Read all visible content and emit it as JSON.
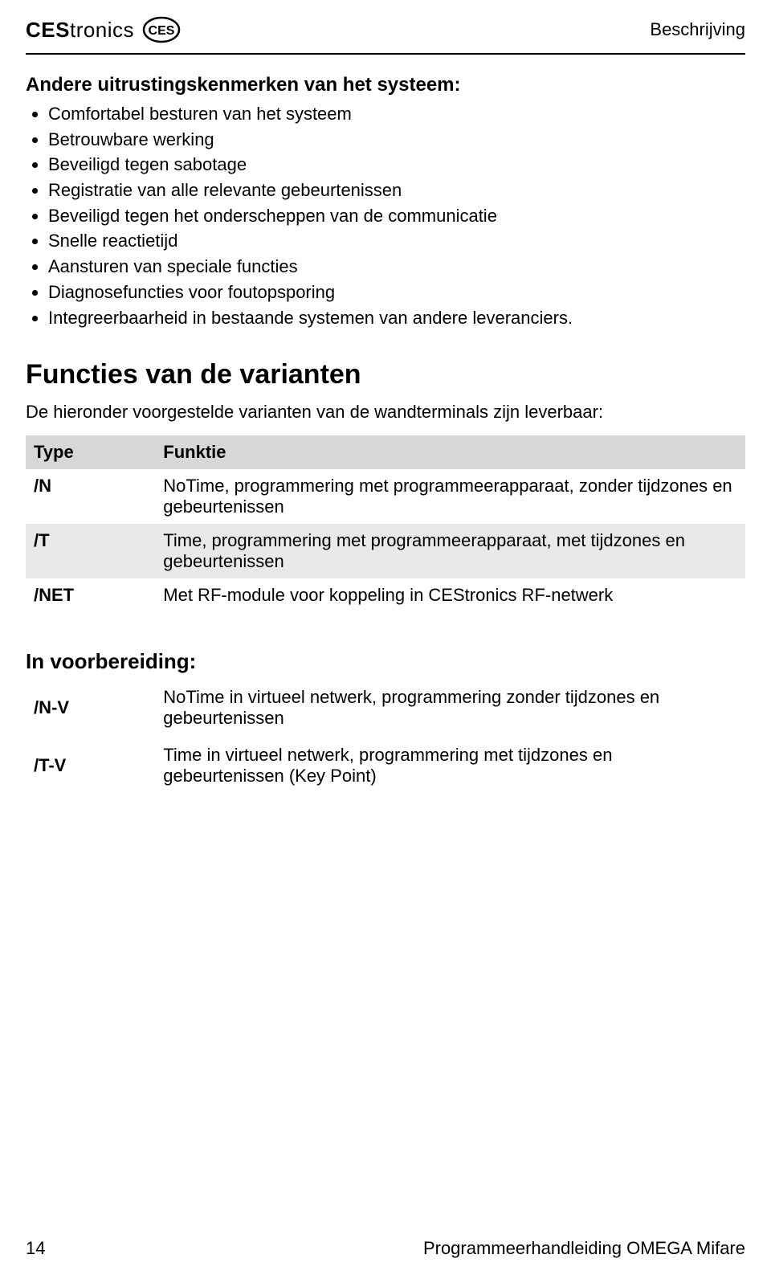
{
  "header": {
    "brand_ces": "CES",
    "brand_tronics": "tronics",
    "right": "Beschrijving"
  },
  "section1": {
    "title": "Andere uitrustingskenmerken van het systeem:",
    "items": [
      "Comfortabel besturen van het systeem",
      "Betrouwbare werking",
      "Beveiligd tegen sabotage",
      "Registratie van alle relevante gebeurtenissen",
      "Beveiligd tegen het onderscheppen van de communicatie",
      "Snelle reactietijd",
      "Aansturen van speciale functies",
      "Diagnosefuncties voor foutopsporing",
      "Integreerbaarheid in bestaande systemen van andere leveranciers."
    ]
  },
  "section2": {
    "heading": "Functies van de varianten",
    "intro": "De hieronder voorgestelde varianten van de wandterminals zijn leverbaar:",
    "table": {
      "header_type": "Type",
      "header_function": "Funktie",
      "rows": [
        {
          "type": "/N",
          "func": "NoTime, programmering met programmeer­apparaat, zonder tijdzones en gebeurtenissen"
        },
        {
          "type": "/T",
          "func": "Time, programmering met programmeerapparaat, met tijdzones en gebeurtenissen"
        },
        {
          "type": "/NET",
          "func": "Met RF-module voor koppeling in CEStronics RF-netwerk"
        }
      ]
    }
  },
  "section3": {
    "heading": "In voorbereiding:",
    "rows": [
      {
        "type": "/N-V",
        "func": "NoTime in virtueel netwerk, programmering zonder tijdzones en gebeurtenissen"
      },
      {
        "type": "/T-V",
        "func": "Time in virtueel netwerk, programmering met tijdzones en gebeurtenissen (Key Point)"
      }
    ]
  },
  "footer": {
    "page": "14",
    "title": "Programmeerhandleiding OMEGA Mifare"
  }
}
